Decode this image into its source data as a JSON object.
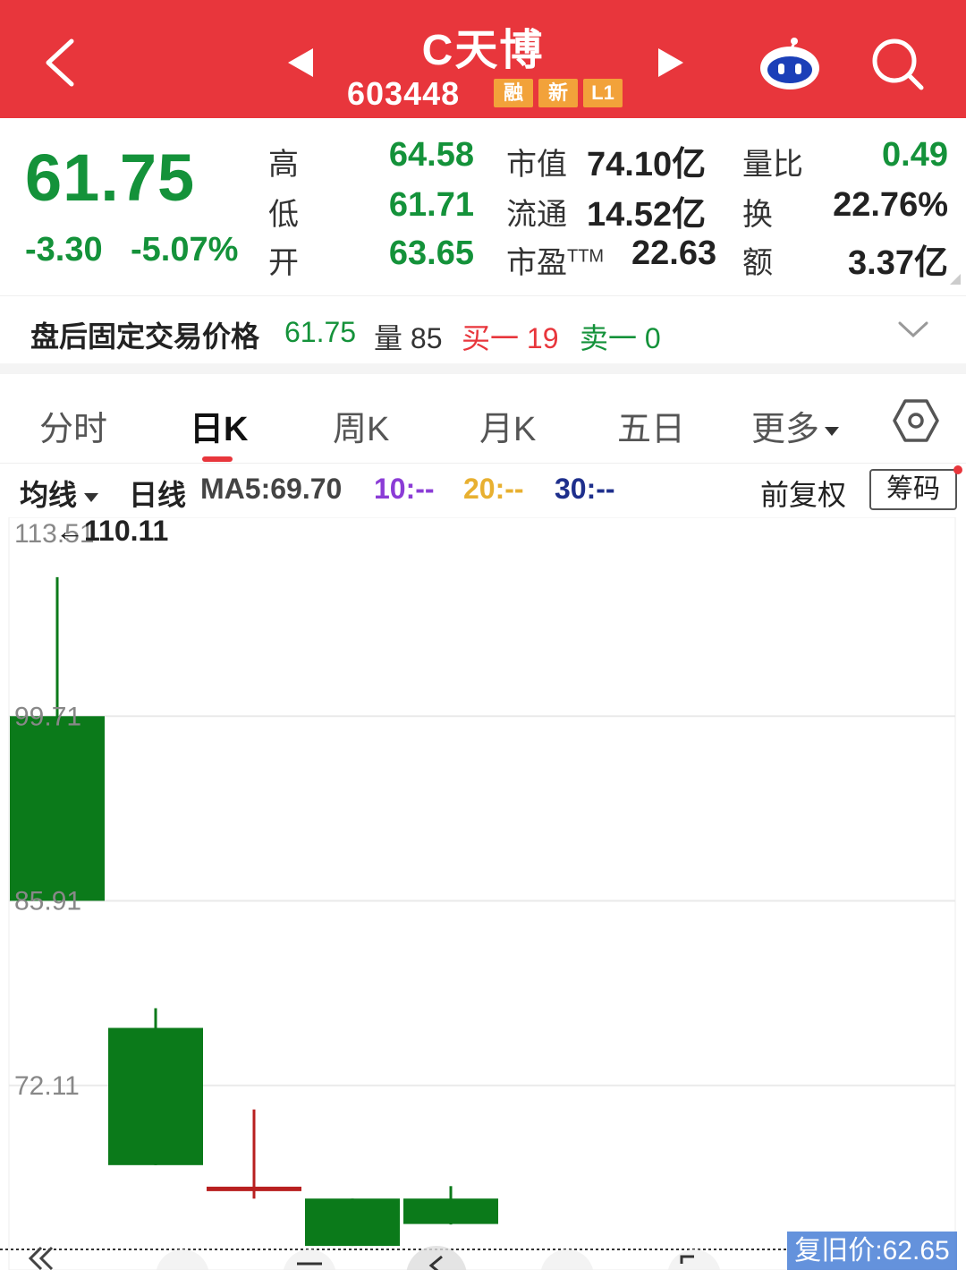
{
  "header": {
    "title": "C天博",
    "code": "603448",
    "badges": [
      "融",
      "新",
      "L1"
    ],
    "color_bg": "#e8363c"
  },
  "quote": {
    "price": "61.75",
    "change": "-3.30",
    "change_pct": "-5.07%",
    "high_label": "高",
    "high": "64.58",
    "low_label": "低",
    "low": "61.71",
    "open_label": "开",
    "open": "63.65",
    "mktcap_label": "市值",
    "mktcap": "74.10亿",
    "float_label": "流通",
    "float": "14.52亿",
    "pe_label": "市盈",
    "pe_ttm": "TTM",
    "pe": "22.63",
    "vol_ratio_label": "量比",
    "vol_ratio": "0.49",
    "turnover_label": "换",
    "turnover": "22.76%",
    "amount_label": "额",
    "amount": "3.37亿",
    "down_color": "#14923a"
  },
  "after_hours": {
    "label": "盘后固定交易价格",
    "price": "61.75",
    "vol_label": "量",
    "vol": "85",
    "buy1": "买一 19",
    "sell1": "卖一 0"
  },
  "tabs": {
    "items": [
      "分时",
      "日K",
      "周K",
      "月K",
      "五日",
      "更多"
    ],
    "active": "日K"
  },
  "ma": {
    "selector": "均线",
    "line": "日线",
    "ma5": "MA5:69.70",
    "ma10": "10:--",
    "ma20": "20:--",
    "ma30": "30:--",
    "adjust": "前复权",
    "chips": "筹码",
    "ma10_color": "#8b3cd6",
    "ma20_color": "#e8b030",
    "ma30_color": "#1e2f8c"
  },
  "chart_data": {
    "type": "candlestick",
    "y_ticks": [
      "113.51",
      "99.71",
      "85.91",
      "72.11"
    ],
    "max_marker": "←110.11",
    "ylim": [
      58.31,
      113.51
    ],
    "candles": [
      {
        "open": 99.71,
        "close": 85.91,
        "high": 110.11,
        "low": 85.91,
        "color": "down"
      },
      {
        "open": 76.41,
        "close": 66.15,
        "high": 77.88,
        "low": 66.15,
        "color": "down"
      },
      {
        "open": 64.54,
        "close": 64.54,
        "high": 70.31,
        "low": 63.65,
        "color": "up"
      },
      {
        "open": 63.65,
        "close": 60.11,
        "high": 63.65,
        "low": 60.11,
        "color": "down"
      },
      {
        "open": 63.65,
        "close": 61.75,
        "high": 64.58,
        "low": 61.71,
        "color": "down"
      }
    ],
    "up_color": "#b82020",
    "down_color": "#0b7a1a"
  },
  "bottom": {
    "price_tag": "复旧价:62.65"
  }
}
